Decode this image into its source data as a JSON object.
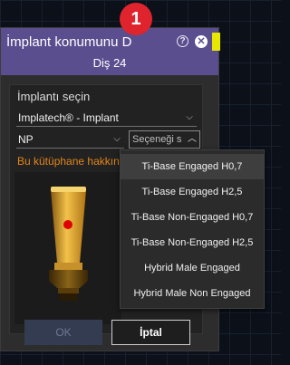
{
  "badge": {
    "number": "1",
    "color": "#e0242e"
  },
  "dialog": {
    "title": "İmplant konumunu D",
    "subtitle": "Diş 24",
    "header_color": "#5a4e8f",
    "help_icon": "help-icon",
    "close_icon": "close-icon"
  },
  "panel": {
    "heading": "İmplantı seçin",
    "library_select": {
      "value": "Implatech® - Implant"
    },
    "type_select": {
      "value": "NP"
    },
    "option_select": {
      "placeholder": "Seçeneği s"
    },
    "library_link": "Bu kütüphane hakkında",
    "link_color": "#e2861a"
  },
  "buttons": {
    "ok": "OK",
    "cancel": "İptal"
  },
  "dropdown": {
    "items": [
      "Ti-Base Engaged H0,7",
      "Ti-Base Engaged H2,5",
      "Ti-Base Non-Engaged H0,7",
      "Ti-Base Non-Engaged H2,5",
      "Hybrid Male Engaged",
      "Hybrid Male Non Engaged"
    ],
    "highlighted_index": 0
  }
}
